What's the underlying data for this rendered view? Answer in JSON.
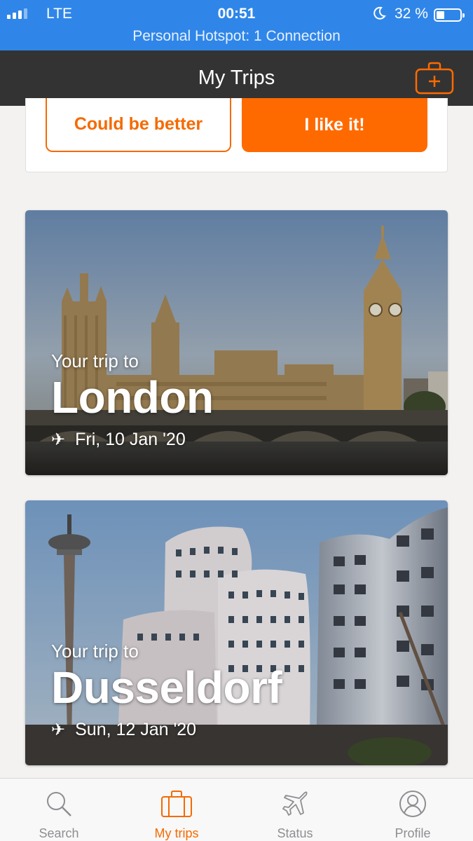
{
  "status_bar": {
    "network": "LTE",
    "time": "00:51",
    "battery": "32 %",
    "battery_level": 0.32,
    "hotspot": "Personal Hotspot: 1 Connection"
  },
  "nav": {
    "title": "My Trips",
    "add_icon": "suitcase-plus-icon"
  },
  "feedback": {
    "negative_label": "Could be better",
    "positive_label": "I like it!"
  },
  "trips": [
    {
      "prefix": "Your trip to",
      "city": "London",
      "date": "Fri, 10 Jan '20",
      "icon": "plane-icon"
    },
    {
      "prefix": "Your trip to",
      "city": "Dusseldorf",
      "date": "Sun, 12 Jan '20",
      "icon": "plane-icon"
    }
  ],
  "tabs": [
    {
      "label": "Search",
      "icon": "search-icon"
    },
    {
      "label": "My trips",
      "icon": "suitcase-icon",
      "active": true
    },
    {
      "label": "Status",
      "icon": "plane-icon"
    },
    {
      "label": "Profile",
      "icon": "user-icon"
    }
  ],
  "colors": {
    "accent": "#ff6a00",
    "status_bar": "#2f86e8",
    "nav_bar": "#333333"
  }
}
